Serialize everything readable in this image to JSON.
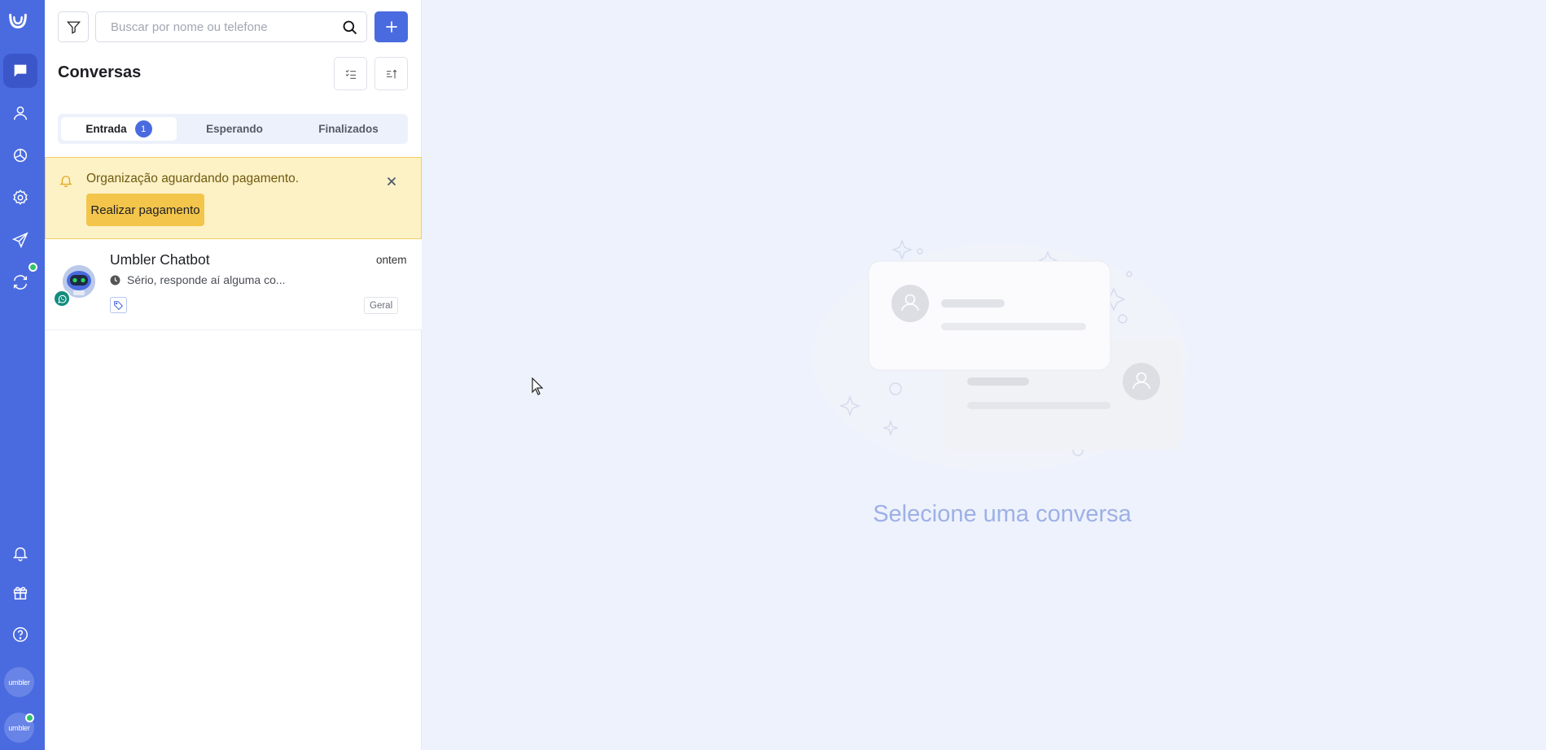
{
  "nav": {
    "items": [
      {
        "icon": "chat-icon"
      },
      {
        "icon": "user-icon"
      },
      {
        "icon": "chart-pie-icon"
      },
      {
        "icon": "gear-icon"
      },
      {
        "icon": "send-icon"
      },
      {
        "icon": "sync-icon"
      }
    ],
    "bottom": [
      {
        "icon": "bell-icon"
      },
      {
        "icon": "gift-icon"
      },
      {
        "icon": "help-icon"
      }
    ],
    "org_avatar": "umbler",
    "user_avatar": "umbler",
    "accent_color": "#4a6bdf"
  },
  "search": {
    "placeholder": "Buscar por nome ou telefone",
    "value": ""
  },
  "conversations": {
    "title": "Conversas",
    "tabs": [
      {
        "label": "Entrada",
        "badge": "1"
      },
      {
        "label": "Esperando"
      },
      {
        "label": "Finalizados"
      }
    ]
  },
  "alert": {
    "text": "Organização aguardando pagamento.",
    "button": "Realizar pagamento"
  },
  "conversation": {
    "name": "Umbler Chatbot",
    "time": "ontem",
    "preview": "Sério, responde aí alguma co...",
    "department": "Geral",
    "channel": "whatsapp-icon"
  },
  "main": {
    "empty_text": "Selecione uma conversa"
  }
}
